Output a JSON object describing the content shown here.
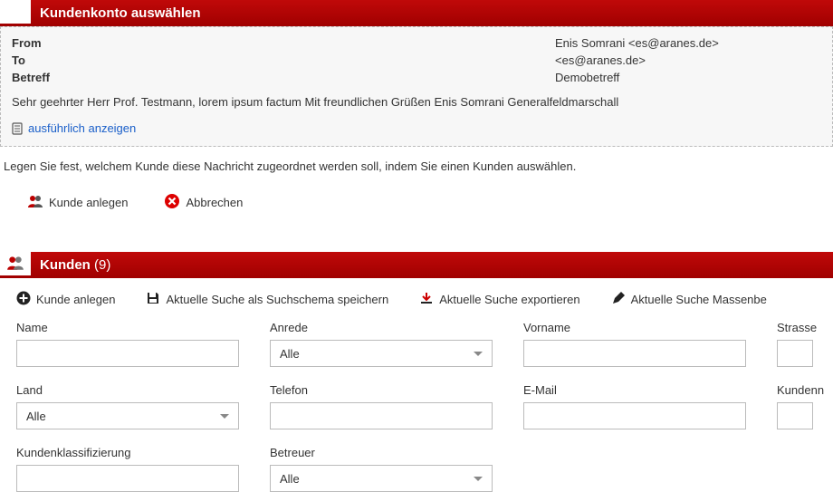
{
  "header1": {
    "title": "Kundenkonto auswählen"
  },
  "info": {
    "from_label": "From",
    "from_value": "Enis Somrani <es@aranes.de>",
    "to_label": "To",
    "to_value": "<es@aranes.de>",
    "subject_label": "Betreff",
    "subject_value": "Demobetreff",
    "body": "Sehr geehrter Herr Prof. Testmann, lorem ipsum factum Mit freundlichen Grüßen Enis Somrani Generalfeldmarschall",
    "detail_link": "ausführlich anzeigen"
  },
  "instruction": "Legen Sie fest, welchem Kunde diese Nachricht zugeordnet werden soll, indem Sie einen Kunden auswählen.",
  "actions": {
    "create": "Kunde anlegen",
    "cancel": "Abbrechen"
  },
  "header2": {
    "title": "Kunden",
    "count": "(9)"
  },
  "toolbar": {
    "create": "Kunde anlegen",
    "save_schema": "Aktuelle Suche als Suchschema speichern",
    "export": "Aktuelle Suche exportieren",
    "massedit": "Aktuelle Suche Massenbe"
  },
  "filters": {
    "name": "Name",
    "anrede": "Anrede",
    "anrede_value": "Alle",
    "vorname": "Vorname",
    "strasse": "Strasse",
    "land": "Land",
    "land_value": "Alle",
    "telefon": "Telefon",
    "email": "E-Mail",
    "kundennr": "Kundenn",
    "klass": "Kundenklassifizierung",
    "betreuer": "Betreuer",
    "betreuer_value": "Alle"
  }
}
